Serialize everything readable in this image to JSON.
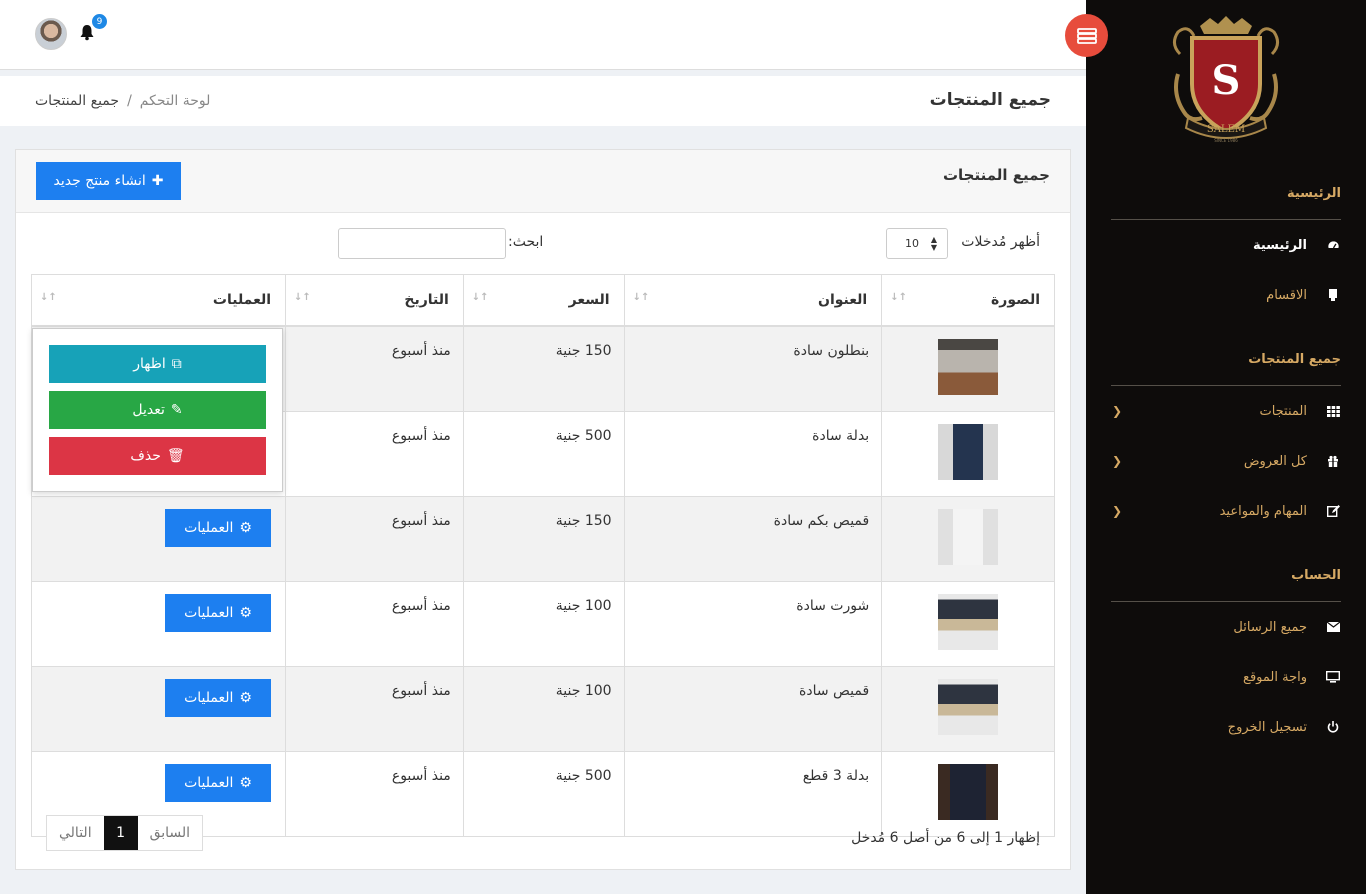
{
  "sidebar": {
    "sections": [
      {
        "title": "الرئيسية"
      },
      {
        "title": "جميع المنتجات"
      },
      {
        "title": "الحساب"
      }
    ],
    "items": [
      {
        "label": "الرئيسية",
        "icon": "dashboard-icon"
      },
      {
        "label": "الاقسام",
        "icon": "bookmark-icon"
      },
      {
        "label": "المنتجات",
        "icon": "grid-icon"
      },
      {
        "label": "كل العروض",
        "icon": "gift-icon"
      },
      {
        "label": "المهام والمواعيد",
        "icon": "edit-icon"
      },
      {
        "label": "جميع الرسائل",
        "icon": "envelope-icon"
      },
      {
        "label": "واجة الموقع",
        "icon": "monitor-icon"
      },
      {
        "label": "تسجيل الخروج",
        "icon": "power-icon"
      }
    ],
    "logo_letter": "S",
    "logo_text": "SALEM",
    "logo_since": "SINCE 1986"
  },
  "topbar": {
    "notifications_count": "9"
  },
  "header": {
    "title": "جميع المنتجات",
    "breadcrumb_home": "لوحة التحكم",
    "breadcrumb_sep": "/",
    "breadcrumb_current": "جميع المنتجات"
  },
  "card": {
    "title": "جميع المنتجات",
    "create_label": "انشاء منتج جديد",
    "length_label": "أظهر مُدخلات",
    "length_value": "10",
    "search_label": "ابحث:",
    "search_value": ""
  },
  "table": {
    "columns": [
      "الصورة",
      "العنوان",
      "السعر",
      "التاريخ",
      "العمليات"
    ],
    "rows": [
      {
        "title": "بنطلون سادة",
        "price": "150 جنية",
        "date": "منذ أسبوع"
      },
      {
        "title": "بدلة سادة",
        "price": "500 جنية",
        "date": "منذ أسبوع"
      },
      {
        "title": "قميص بكم سادة",
        "price": "150 جنية",
        "date": "منذ أسبوع"
      },
      {
        "title": "شورت سادة",
        "price": "100 جنية",
        "date": "منذ أسبوع"
      },
      {
        "title": "قميص سادة",
        "price": "100 جنية",
        "date": "منذ أسبوع"
      },
      {
        "title": "بدلة 3 قطع",
        "price": "500 جنية",
        "date": "منذ أسبوع"
      }
    ],
    "ops_label": "العمليات"
  },
  "dropdown": {
    "show_label": "اظهار",
    "edit_label": "تعديل",
    "delete_label": "حذف"
  },
  "footer": {
    "info": "إظهار 1 إلى 6 من أصل 6 مُدخل",
    "prev_label": "السابق",
    "page": "1",
    "next_label": "التالي"
  },
  "colors": {
    "primary": "#1d7ff0",
    "info": "#17a2b8",
    "success": "#28a745",
    "danger": "#dc3545",
    "sidebar_bg": "#0e0c0b",
    "sidebar_text": "#d6a964"
  }
}
